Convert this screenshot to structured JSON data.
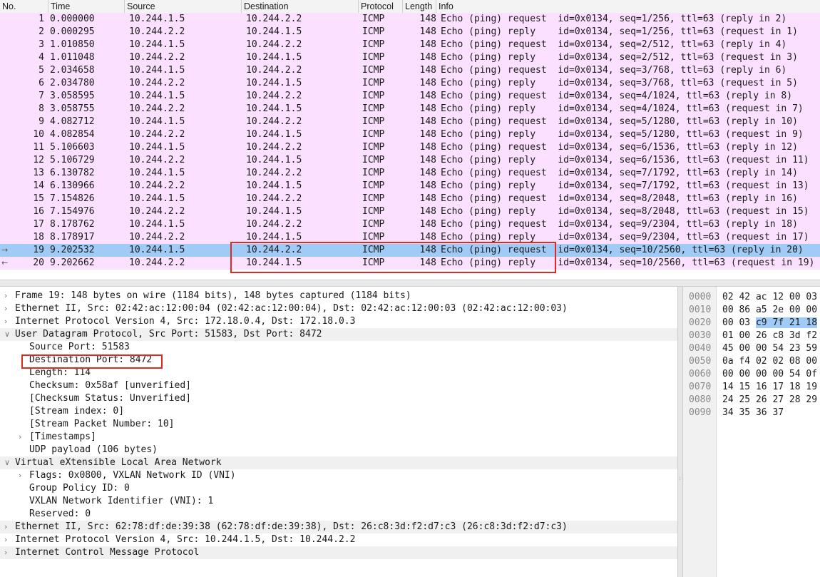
{
  "packet_list": {
    "columns": [
      "No.",
      "Time",
      "Source",
      "Destination",
      "Protocol",
      "Length",
      "Info"
    ],
    "rows": [
      {
        "no": "1",
        "time": "0.000000",
        "src": "10.244.1.5",
        "dst": "10.244.2.2",
        "proto": "ICMP",
        "len": "148",
        "info": "Echo (ping) request  id=0x0134, seq=1/256, ttl=63 (reply in 2)"
      },
      {
        "no": "2",
        "time": "0.000295",
        "src": "10.244.2.2",
        "dst": "10.244.1.5",
        "proto": "ICMP",
        "len": "148",
        "info": "Echo (ping) reply    id=0x0134, seq=1/256, ttl=63 (request in 1)"
      },
      {
        "no": "3",
        "time": "1.010850",
        "src": "10.244.1.5",
        "dst": "10.244.2.2",
        "proto": "ICMP",
        "len": "148",
        "info": "Echo (ping) request  id=0x0134, seq=2/512, ttl=63 (reply in 4)"
      },
      {
        "no": "4",
        "time": "1.011048",
        "src": "10.244.2.2",
        "dst": "10.244.1.5",
        "proto": "ICMP",
        "len": "148",
        "info": "Echo (ping) reply    id=0x0134, seq=2/512, ttl=63 (request in 3)"
      },
      {
        "no": "5",
        "time": "2.034658",
        "src": "10.244.1.5",
        "dst": "10.244.2.2",
        "proto": "ICMP",
        "len": "148",
        "info": "Echo (ping) request  id=0x0134, seq=3/768, ttl=63 (reply in 6)"
      },
      {
        "no": "6",
        "time": "2.034780",
        "src": "10.244.2.2",
        "dst": "10.244.1.5",
        "proto": "ICMP",
        "len": "148",
        "info": "Echo (ping) reply    id=0x0134, seq=3/768, ttl=63 (request in 5)"
      },
      {
        "no": "7",
        "time": "3.058595",
        "src": "10.244.1.5",
        "dst": "10.244.2.2",
        "proto": "ICMP",
        "len": "148",
        "info": "Echo (ping) request  id=0x0134, seq=4/1024, ttl=63 (reply in 8)"
      },
      {
        "no": "8",
        "time": "3.058755",
        "src": "10.244.2.2",
        "dst": "10.244.1.5",
        "proto": "ICMP",
        "len": "148",
        "info": "Echo (ping) reply    id=0x0134, seq=4/1024, ttl=63 (request in 7)"
      },
      {
        "no": "9",
        "time": "4.082712",
        "src": "10.244.1.5",
        "dst": "10.244.2.2",
        "proto": "ICMP",
        "len": "148",
        "info": "Echo (ping) request  id=0x0134, seq=5/1280, ttl=63 (reply in 10)"
      },
      {
        "no": "10",
        "time": "4.082854",
        "src": "10.244.2.2",
        "dst": "10.244.1.5",
        "proto": "ICMP",
        "len": "148",
        "info": "Echo (ping) reply    id=0x0134, seq=5/1280, ttl=63 (request in 9)"
      },
      {
        "no": "11",
        "time": "5.106603",
        "src": "10.244.1.5",
        "dst": "10.244.2.2",
        "proto": "ICMP",
        "len": "148",
        "info": "Echo (ping) request  id=0x0134, seq=6/1536, ttl=63 (reply in 12)"
      },
      {
        "no": "12",
        "time": "5.106729",
        "src": "10.244.2.2",
        "dst": "10.244.1.5",
        "proto": "ICMP",
        "len": "148",
        "info": "Echo (ping) reply    id=0x0134, seq=6/1536, ttl=63 (request in 11)"
      },
      {
        "no": "13",
        "time": "6.130782",
        "src": "10.244.1.5",
        "dst": "10.244.2.2",
        "proto": "ICMP",
        "len": "148",
        "info": "Echo (ping) request  id=0x0134, seq=7/1792, ttl=63 (reply in 14)"
      },
      {
        "no": "14",
        "time": "6.130966",
        "src": "10.244.2.2",
        "dst": "10.244.1.5",
        "proto": "ICMP",
        "len": "148",
        "info": "Echo (ping) reply    id=0x0134, seq=7/1792, ttl=63 (request in 13)"
      },
      {
        "no": "15",
        "time": "7.154826",
        "src": "10.244.1.5",
        "dst": "10.244.2.2",
        "proto": "ICMP",
        "len": "148",
        "info": "Echo (ping) request  id=0x0134, seq=8/2048, ttl=63 (reply in 16)"
      },
      {
        "no": "16",
        "time": "7.154976",
        "src": "10.244.2.2",
        "dst": "10.244.1.5",
        "proto": "ICMP",
        "len": "148",
        "info": "Echo (ping) reply    id=0x0134, seq=8/2048, ttl=63 (request in 15)"
      },
      {
        "no": "17",
        "time": "8.178762",
        "src": "10.244.1.5",
        "dst": "10.244.2.2",
        "proto": "ICMP",
        "len": "148",
        "info": "Echo (ping) request  id=0x0134, seq=9/2304, ttl=63 (reply in 18)"
      },
      {
        "no": "18",
        "time": "8.178917",
        "src": "10.244.2.2",
        "dst": "10.244.1.5",
        "proto": "ICMP",
        "len": "148",
        "info": "Echo (ping) reply    id=0x0134, seq=9/2304, ttl=63 (request in 17)"
      },
      {
        "no": "19",
        "time": "9.202532",
        "src": "10.244.1.5",
        "dst": "10.244.2.2",
        "proto": "ICMP",
        "len": "148",
        "info": "Echo (ping) request  id=0x0134, seq=10/2560, ttl=63 (reply in 20)"
      },
      {
        "no": "20",
        "time": "9.202662",
        "src": "10.244.2.2",
        "dst": "10.244.1.5",
        "proto": "ICMP",
        "len": "148",
        "info": "Echo (ping) reply    id=0x0134, seq=10/2560, ttl=63 (request in 19)"
      }
    ],
    "selected_no": "19",
    "colors": {
      "row": "#fce0ff",
      "selected": "#9fcbf6",
      "highlight_box": "#e02a1f"
    }
  },
  "details": [
    {
      "level": 0,
      "expander": "closed",
      "text": "Frame 19: 148 bytes on wire (1184 bits), 148 bytes captured (1184 bits)"
    },
    {
      "level": 0,
      "expander": "closed",
      "text": "Ethernet II, Src: 02:42:ac:12:00:04 (02:42:ac:12:00:04), Dst: 02:42:ac:12:00:03 (02:42:ac:12:00:03)"
    },
    {
      "level": 0,
      "expander": "closed",
      "text": "Internet Protocol Version 4, Src: 172.18.0.4, Dst: 172.18.0.3"
    },
    {
      "level": 0,
      "expander": "open",
      "text": "User Datagram Protocol, Src Port: 51583, Dst Port: 8472",
      "alt": true
    },
    {
      "level": 1,
      "expander": "none",
      "text": "Source Port: 51583"
    },
    {
      "level": 1,
      "expander": "none",
      "text": "Destination Port: 8472",
      "boxed": true
    },
    {
      "level": 1,
      "expander": "none",
      "text": "Length: 114"
    },
    {
      "level": 1,
      "expander": "none",
      "text": "Checksum: 0x58af [unverified]"
    },
    {
      "level": 1,
      "expander": "none",
      "text": "[Checksum Status: Unverified]"
    },
    {
      "level": 1,
      "expander": "none",
      "text": "[Stream index: 0]"
    },
    {
      "level": 1,
      "expander": "none",
      "text": "[Stream Packet Number: 10]"
    },
    {
      "level": 1,
      "expander": "closed",
      "text": "[Timestamps]"
    },
    {
      "level": 1,
      "expander": "none",
      "text": "UDP payload (106 bytes)"
    },
    {
      "level": 0,
      "expander": "open",
      "text": "Virtual eXtensible Local Area Network",
      "alt": true
    },
    {
      "level": 1,
      "expander": "closed",
      "text": "Flags: 0x0800, VXLAN Network ID (VNI)"
    },
    {
      "level": 1,
      "expander": "none",
      "text": "Group Policy ID: 0"
    },
    {
      "level": 1,
      "expander": "none",
      "text": "VXLAN Network Identifier (VNI): 1"
    },
    {
      "level": 1,
      "expander": "none",
      "text": "Reserved: 0"
    },
    {
      "level": 0,
      "expander": "closed",
      "text": "Ethernet II, Src: 62:78:df:de:39:38 (62:78:df:de:39:38), Dst: 26:c8:3d:f2:d7:c3 (26:c8:3d:f2:d7:c3)",
      "alt": true
    },
    {
      "level": 0,
      "expander": "closed",
      "text": "Internet Protocol Version 4, Src: 10.244.1.5, Dst: 10.244.2.2"
    },
    {
      "level": 0,
      "expander": "closed",
      "text": "Internet Control Message Protocol",
      "alt": true
    }
  ],
  "hex": [
    {
      "offset": "0000",
      "bytes": "02 42 ac 12 00 03"
    },
    {
      "offset": "0010",
      "bytes": "00 86 a5 2e 00 00"
    },
    {
      "offset": "0020",
      "bytes": "00 03 ",
      "hl": "c9 7f 21 18"
    },
    {
      "offset": "0030",
      "bytes": "01 00 26 c8 3d f2"
    },
    {
      "offset": "0040",
      "bytes": "45 00 00 54 23 59"
    },
    {
      "offset": "0050",
      "bytes": "0a f4 02 02 08 00"
    },
    {
      "offset": "0060",
      "bytes": "00 00 00 00 54 0f"
    },
    {
      "offset": "0070",
      "bytes": "14 15 16 17 18 19"
    },
    {
      "offset": "0080",
      "bytes": "24 25 26 27 28 29"
    },
    {
      "offset": "0090",
      "bytes": "34 35 36 37"
    }
  ]
}
